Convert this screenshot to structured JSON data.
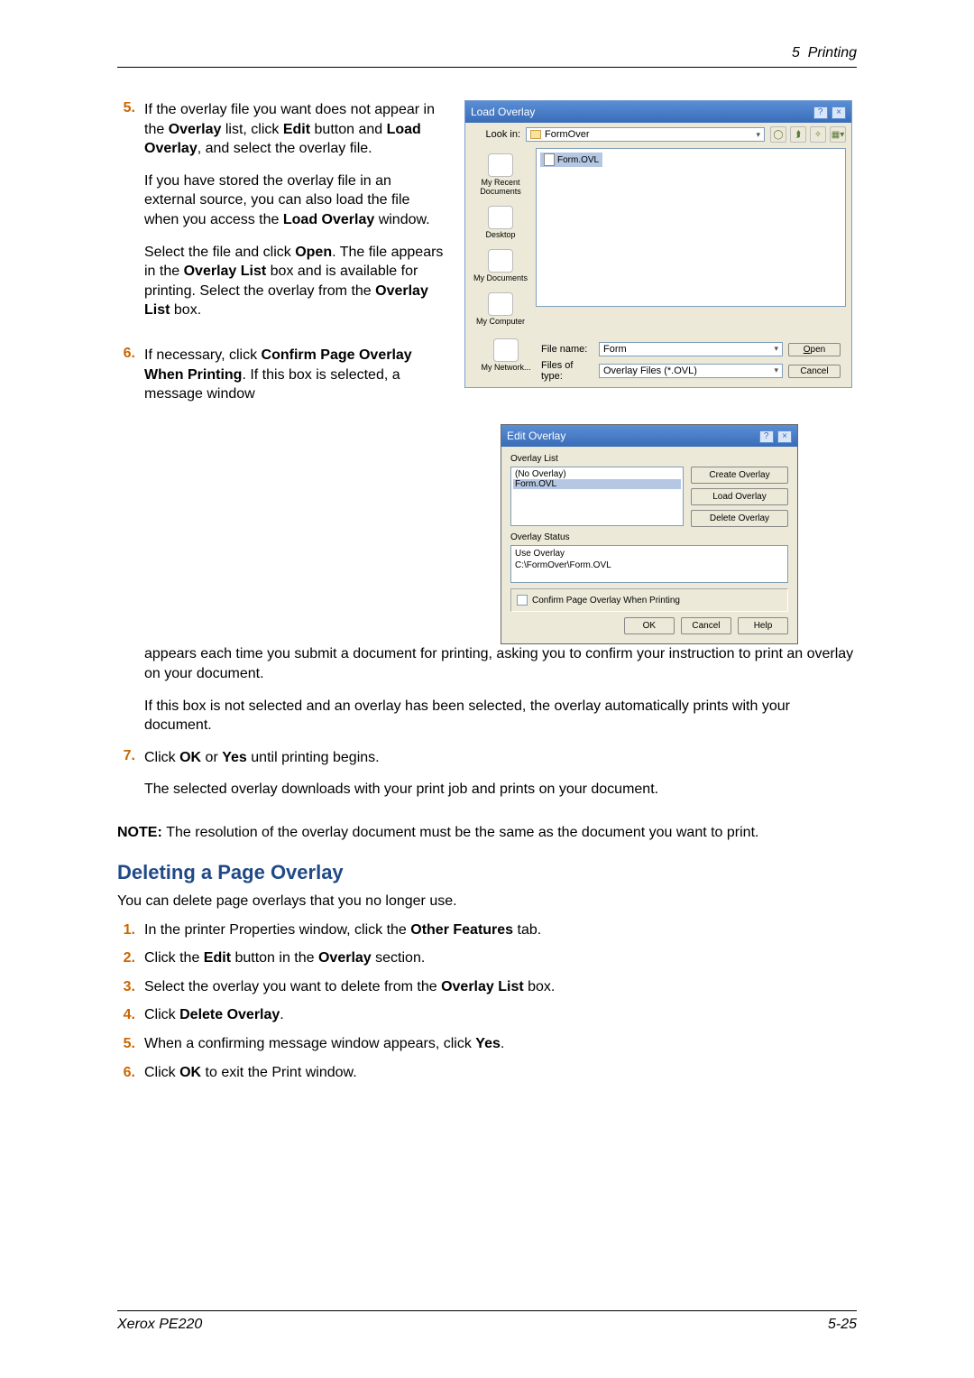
{
  "header": {
    "chapter": "5",
    "title": "Printing"
  },
  "steps_top": {
    "s5": {
      "num": "5.",
      "p1_a": "If the overlay file you want does not appear in the ",
      "p1_b1": "Over­lay",
      "p1_c": " list, click ",
      "p1_b2": "Edit",
      "p1_d": " but­ton and ",
      "p1_b3": "Load Overlay",
      "p1_e": ", and select the overlay file.",
      "p2_a": "If you have stored the overlay file in an external source, you can also load the file when you access the ",
      "p2_b": "Load Overlay",
      "p2_c": " window.",
      "p3_a": "Select the file and click ",
      "p3_b1": "Open",
      "p3_c": ". The file appears in the ",
      "p3_b2": "Overlay List",
      "p3_d": " box and is available for printing. Select the overlay from the ",
      "p3_b3": "Overlay List",
      "p3_e": " box."
    },
    "s6": {
      "num": "6.",
      "p1_a": "If necessary, click ",
      "p1_b": "Confirm Page Over­lay When Printing",
      "p1_c": ". If this box is selected, a message window appears each time you submit a document for printing, asking you to confirm your instruction to print an overlay on your document.",
      "p2": "If this box is not selected and an overlay has been selected, the overlay automatically prints with your document."
    },
    "s7": {
      "num": "7.",
      "p1_a": "Click ",
      "p1_b1": "OK",
      "p1_c": " or ",
      "p1_b2": "Yes",
      "p1_d": " until printing begins.",
      "p2": "The selected overlay downloads with your print job and prints on your document."
    }
  },
  "note": {
    "b": "NOTE: ",
    "t": "The resolution of the overlay document must be the same as the document you want to print."
  },
  "section": {
    "title": "Deleting a Page Overlay",
    "intro": "You can delete page overlays that you no longer use.",
    "d1": {
      "n": "1.",
      "a": "In the printer Properties window, click the ",
      "b": "Other Features",
      "c": " tab."
    },
    "d2": {
      "n": "2.",
      "a": "Click the ",
      "b1": "Edit",
      "c": " button in the ",
      "b2": "Overlay",
      "d": " section."
    },
    "d3": {
      "n": "3.",
      "a": "Select the overlay you want to delete from the ",
      "b": "Overlay List",
      "c": " box."
    },
    "d4": {
      "n": "4.",
      "a": "Click ",
      "b": "Delete Overlay",
      "c": "."
    },
    "d5": {
      "n": "5.",
      "a": "When a confirming message window appears, click ",
      "b": "Yes",
      "c": "."
    },
    "d6": {
      "n": "6.",
      "a": "Click ",
      "b": "OK",
      "c": " to exit the Print window."
    }
  },
  "load_dlg": {
    "title": "Load Overlay",
    "lookin_label": "Look in:",
    "lookin_value": "FormOver",
    "file_item": "Form.OVL",
    "sb1": "My Recent Documents",
    "sb2": "Desktop",
    "sb3": "My Documents",
    "sb4": "My Computer",
    "sb5": "My Network...",
    "filename_label": "File name:",
    "filename_value": "Form",
    "filetype_label": "Files of type:",
    "filetype_value": "Overlay Files (*.OVL)",
    "open": "Open",
    "cancel": "Cancel"
  },
  "edit_dlg": {
    "title": "Edit Overlay",
    "list_label": "Overlay List",
    "li1": "(No Overlay)",
    "li2": "Form.OVL",
    "btn_create": "Create Overlay",
    "btn_load": "Load Overlay",
    "btn_delete": "Delete Overlay",
    "status_label": "Overlay Status",
    "status_l1": "Use Overlay",
    "status_l2": "C:\\FormOver\\Form.OVL",
    "chk": "Confirm Page Overlay When Printing",
    "ok": "OK",
    "cancel": "Cancel",
    "help": "Help"
  },
  "footer": {
    "product": "Xerox PE220",
    "page": "5-25"
  }
}
